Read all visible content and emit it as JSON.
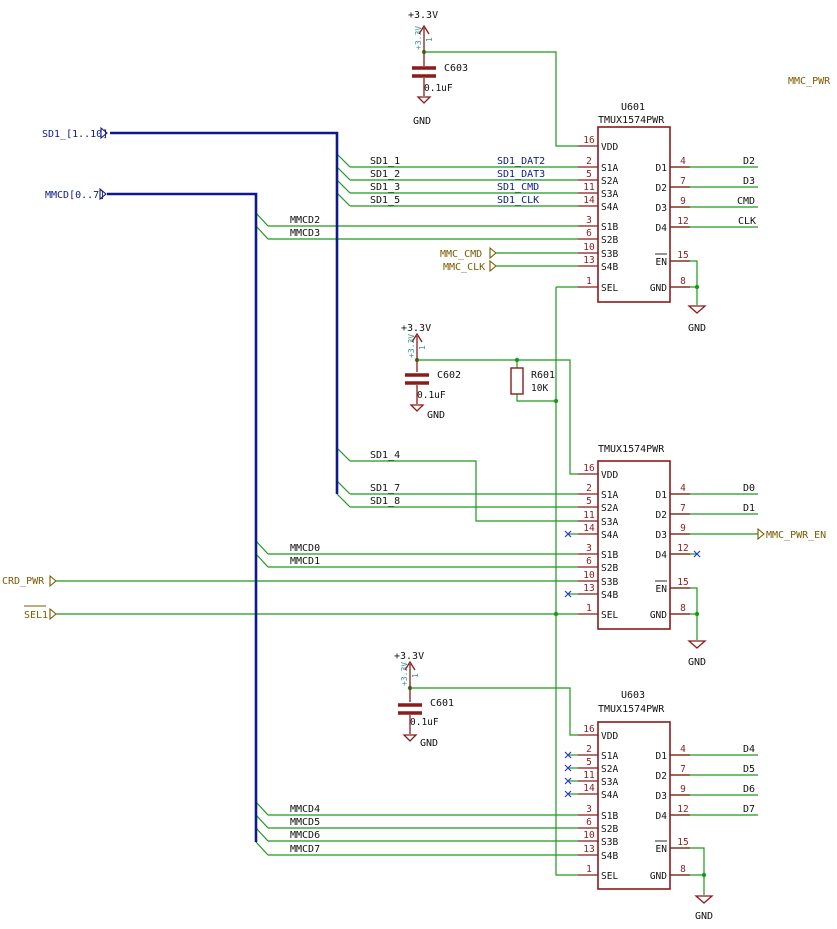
{
  "power": {
    "vcc": "+3.3V",
    "gnd": "GND"
  },
  "caps": [
    {
      "ref": "C603",
      "value": "0.1uF"
    },
    {
      "ref": "C602",
      "value": "0.1uF"
    },
    {
      "ref": "C601",
      "value": "0.1uF"
    }
  ],
  "resistor": {
    "ref": "R601",
    "value": "10K"
  },
  "hidden_pins": {
    "pwr_pin": "1",
    "pwr_pin_name": "+3.3V"
  },
  "chips": [
    {
      "ref": "U601",
      "value": "TMUX1574PWR"
    },
    {
      "ref": "",
      "value": "TMUX1574PWR"
    },
    {
      "ref": "U603",
      "value": "TMUX1574PWR"
    }
  ],
  "pin_names": {
    "left": [
      "VDD",
      "S1A",
      "S2A",
      "S3A",
      "S4A",
      "S1B",
      "S2B",
      "S3B",
      "S4B",
      "SEL"
    ],
    "right": [
      "D1",
      "D2",
      "D3",
      "D4",
      "EN",
      "GND"
    ]
  },
  "chip_pins": [
    {
      "left": [
        "16",
        "2",
        "5",
        "11",
        "14",
        "3",
        "6",
        "10",
        "13",
        "1"
      ],
      "right": [
        "4",
        "7",
        "9",
        "12",
        "15",
        "8"
      ]
    },
    {
      "left": [
        "16",
        "2",
        "5",
        "11",
        "14",
        "3",
        "6",
        "10",
        "13",
        "1"
      ],
      "right": [
        "4",
        "7",
        "9",
        "12",
        "15",
        "8"
      ]
    },
    {
      "left": [
        "16",
        "2",
        "5",
        "11",
        "14",
        "3",
        "6",
        "10",
        "13",
        "1"
      ],
      "right": [
        "4",
        "7",
        "9",
        "12",
        "15",
        "8"
      ]
    }
  ],
  "buses": {
    "sd1": "SD1_[1..10]",
    "mmcd": "MMCD[0..7]"
  },
  "globals": {
    "mmc_pwr": "MMC_PWR",
    "mmc_cmd": "MMC_CMD",
    "mmc_clk": "MMC_CLK",
    "mmc_pwr_en": "MMC_PWR_EN",
    "crd_pwr": "CRD_PWR",
    "sel1": "SEL1"
  },
  "nets": {
    "u601_bus": [
      "SD1_1",
      "SD1_2",
      "SD1_3",
      "SD1_5"
    ],
    "u601_sd": [
      "SD1_DAT2",
      "SD1_DAT3",
      "SD1_CMD",
      "SD1_CLK"
    ],
    "u601_mmcd": [
      "MMCD2",
      "MMCD3"
    ],
    "u601_out": [
      "D2",
      "D3",
      "CMD",
      "CLK"
    ],
    "u602_bus": [
      "SD1_4",
      "SD1_7",
      "SD1_8"
    ],
    "u602_mmcd": [
      "MMCD0",
      "MMCD1"
    ],
    "u602_out": [
      "D0",
      "D1"
    ],
    "u603_mmcd": [
      "MMCD4",
      "MMCD5",
      "MMCD6",
      "MMCD7"
    ],
    "u603_out": [
      "D4",
      "D5",
      "D6",
      "D7"
    ]
  }
}
